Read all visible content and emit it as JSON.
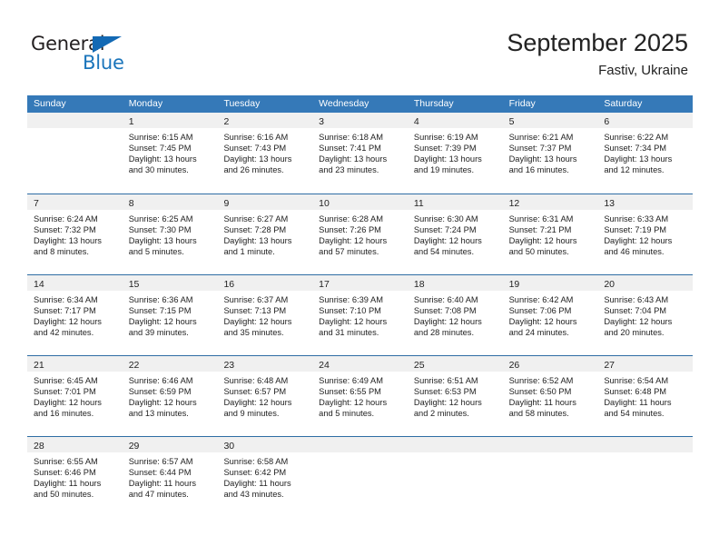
{
  "brand": {
    "name_dark": "General",
    "name_blue": "Blue",
    "accent_color": "#1b75bb",
    "triangle_color": "#1369b4"
  },
  "header": {
    "title": "September 2025",
    "subtitle": "Fastiv, Ukraine"
  },
  "colors": {
    "header_row_bg": "#3579b8",
    "week_divider": "#2e6da4",
    "daynum_bg": "#f0f0f0",
    "text": "#222222"
  },
  "weekdays": [
    "Sunday",
    "Monday",
    "Tuesday",
    "Wednesday",
    "Thursday",
    "Friday",
    "Saturday"
  ],
  "weeks": [
    [
      {
        "day": "",
        "sunrise": "",
        "sunset": "",
        "daylight1": "",
        "daylight2": ""
      },
      {
        "day": "1",
        "sunrise": "Sunrise: 6:15 AM",
        "sunset": "Sunset: 7:45 PM",
        "daylight1": "Daylight: 13 hours",
        "daylight2": "and 30 minutes."
      },
      {
        "day": "2",
        "sunrise": "Sunrise: 6:16 AM",
        "sunset": "Sunset: 7:43 PM",
        "daylight1": "Daylight: 13 hours",
        "daylight2": "and 26 minutes."
      },
      {
        "day": "3",
        "sunrise": "Sunrise: 6:18 AM",
        "sunset": "Sunset: 7:41 PM",
        "daylight1": "Daylight: 13 hours",
        "daylight2": "and 23 minutes."
      },
      {
        "day": "4",
        "sunrise": "Sunrise: 6:19 AM",
        "sunset": "Sunset: 7:39 PM",
        "daylight1": "Daylight: 13 hours",
        "daylight2": "and 19 minutes."
      },
      {
        "day": "5",
        "sunrise": "Sunrise: 6:21 AM",
        "sunset": "Sunset: 7:37 PM",
        "daylight1": "Daylight: 13 hours",
        "daylight2": "and 16 minutes."
      },
      {
        "day": "6",
        "sunrise": "Sunrise: 6:22 AM",
        "sunset": "Sunset: 7:34 PM",
        "daylight1": "Daylight: 13 hours",
        "daylight2": "and 12 minutes."
      }
    ],
    [
      {
        "day": "7",
        "sunrise": "Sunrise: 6:24 AM",
        "sunset": "Sunset: 7:32 PM",
        "daylight1": "Daylight: 13 hours",
        "daylight2": "and 8 minutes."
      },
      {
        "day": "8",
        "sunrise": "Sunrise: 6:25 AM",
        "sunset": "Sunset: 7:30 PM",
        "daylight1": "Daylight: 13 hours",
        "daylight2": "and 5 minutes."
      },
      {
        "day": "9",
        "sunrise": "Sunrise: 6:27 AM",
        "sunset": "Sunset: 7:28 PM",
        "daylight1": "Daylight: 13 hours",
        "daylight2": "and 1 minute."
      },
      {
        "day": "10",
        "sunrise": "Sunrise: 6:28 AM",
        "sunset": "Sunset: 7:26 PM",
        "daylight1": "Daylight: 12 hours",
        "daylight2": "and 57 minutes."
      },
      {
        "day": "11",
        "sunrise": "Sunrise: 6:30 AM",
        "sunset": "Sunset: 7:24 PM",
        "daylight1": "Daylight: 12 hours",
        "daylight2": "and 54 minutes."
      },
      {
        "day": "12",
        "sunrise": "Sunrise: 6:31 AM",
        "sunset": "Sunset: 7:21 PM",
        "daylight1": "Daylight: 12 hours",
        "daylight2": "and 50 minutes."
      },
      {
        "day": "13",
        "sunrise": "Sunrise: 6:33 AM",
        "sunset": "Sunset: 7:19 PM",
        "daylight1": "Daylight: 12 hours",
        "daylight2": "and 46 minutes."
      }
    ],
    [
      {
        "day": "14",
        "sunrise": "Sunrise: 6:34 AM",
        "sunset": "Sunset: 7:17 PM",
        "daylight1": "Daylight: 12 hours",
        "daylight2": "and 42 minutes."
      },
      {
        "day": "15",
        "sunrise": "Sunrise: 6:36 AM",
        "sunset": "Sunset: 7:15 PM",
        "daylight1": "Daylight: 12 hours",
        "daylight2": "and 39 minutes."
      },
      {
        "day": "16",
        "sunrise": "Sunrise: 6:37 AM",
        "sunset": "Sunset: 7:13 PM",
        "daylight1": "Daylight: 12 hours",
        "daylight2": "and 35 minutes."
      },
      {
        "day": "17",
        "sunrise": "Sunrise: 6:39 AM",
        "sunset": "Sunset: 7:10 PM",
        "daylight1": "Daylight: 12 hours",
        "daylight2": "and 31 minutes."
      },
      {
        "day": "18",
        "sunrise": "Sunrise: 6:40 AM",
        "sunset": "Sunset: 7:08 PM",
        "daylight1": "Daylight: 12 hours",
        "daylight2": "and 28 minutes."
      },
      {
        "day": "19",
        "sunrise": "Sunrise: 6:42 AM",
        "sunset": "Sunset: 7:06 PM",
        "daylight1": "Daylight: 12 hours",
        "daylight2": "and 24 minutes."
      },
      {
        "day": "20",
        "sunrise": "Sunrise: 6:43 AM",
        "sunset": "Sunset: 7:04 PM",
        "daylight1": "Daylight: 12 hours",
        "daylight2": "and 20 minutes."
      }
    ],
    [
      {
        "day": "21",
        "sunrise": "Sunrise: 6:45 AM",
        "sunset": "Sunset: 7:01 PM",
        "daylight1": "Daylight: 12 hours",
        "daylight2": "and 16 minutes."
      },
      {
        "day": "22",
        "sunrise": "Sunrise: 6:46 AM",
        "sunset": "Sunset: 6:59 PM",
        "daylight1": "Daylight: 12 hours",
        "daylight2": "and 13 minutes."
      },
      {
        "day": "23",
        "sunrise": "Sunrise: 6:48 AM",
        "sunset": "Sunset: 6:57 PM",
        "daylight1": "Daylight: 12 hours",
        "daylight2": "and 9 minutes."
      },
      {
        "day": "24",
        "sunrise": "Sunrise: 6:49 AM",
        "sunset": "Sunset: 6:55 PM",
        "daylight1": "Daylight: 12 hours",
        "daylight2": "and 5 minutes."
      },
      {
        "day": "25",
        "sunrise": "Sunrise: 6:51 AM",
        "sunset": "Sunset: 6:53 PM",
        "daylight1": "Daylight: 12 hours",
        "daylight2": "and 2 minutes."
      },
      {
        "day": "26",
        "sunrise": "Sunrise: 6:52 AM",
        "sunset": "Sunset: 6:50 PM",
        "daylight1": "Daylight: 11 hours",
        "daylight2": "and 58 minutes."
      },
      {
        "day": "27",
        "sunrise": "Sunrise: 6:54 AM",
        "sunset": "Sunset: 6:48 PM",
        "daylight1": "Daylight: 11 hours",
        "daylight2": "and 54 minutes."
      }
    ],
    [
      {
        "day": "28",
        "sunrise": "Sunrise: 6:55 AM",
        "sunset": "Sunset: 6:46 PM",
        "daylight1": "Daylight: 11 hours",
        "daylight2": "and 50 minutes."
      },
      {
        "day": "29",
        "sunrise": "Sunrise: 6:57 AM",
        "sunset": "Sunset: 6:44 PM",
        "daylight1": "Daylight: 11 hours",
        "daylight2": "and 47 minutes."
      },
      {
        "day": "30",
        "sunrise": "Sunrise: 6:58 AM",
        "sunset": "Sunset: 6:42 PM",
        "daylight1": "Daylight: 11 hours",
        "daylight2": "and 43 minutes."
      },
      {
        "day": "",
        "sunrise": "",
        "sunset": "",
        "daylight1": "",
        "daylight2": ""
      },
      {
        "day": "",
        "sunrise": "",
        "sunset": "",
        "daylight1": "",
        "daylight2": ""
      },
      {
        "day": "",
        "sunrise": "",
        "sunset": "",
        "daylight1": "",
        "daylight2": ""
      },
      {
        "day": "",
        "sunrise": "",
        "sunset": "",
        "daylight1": "",
        "daylight2": ""
      }
    ]
  ]
}
